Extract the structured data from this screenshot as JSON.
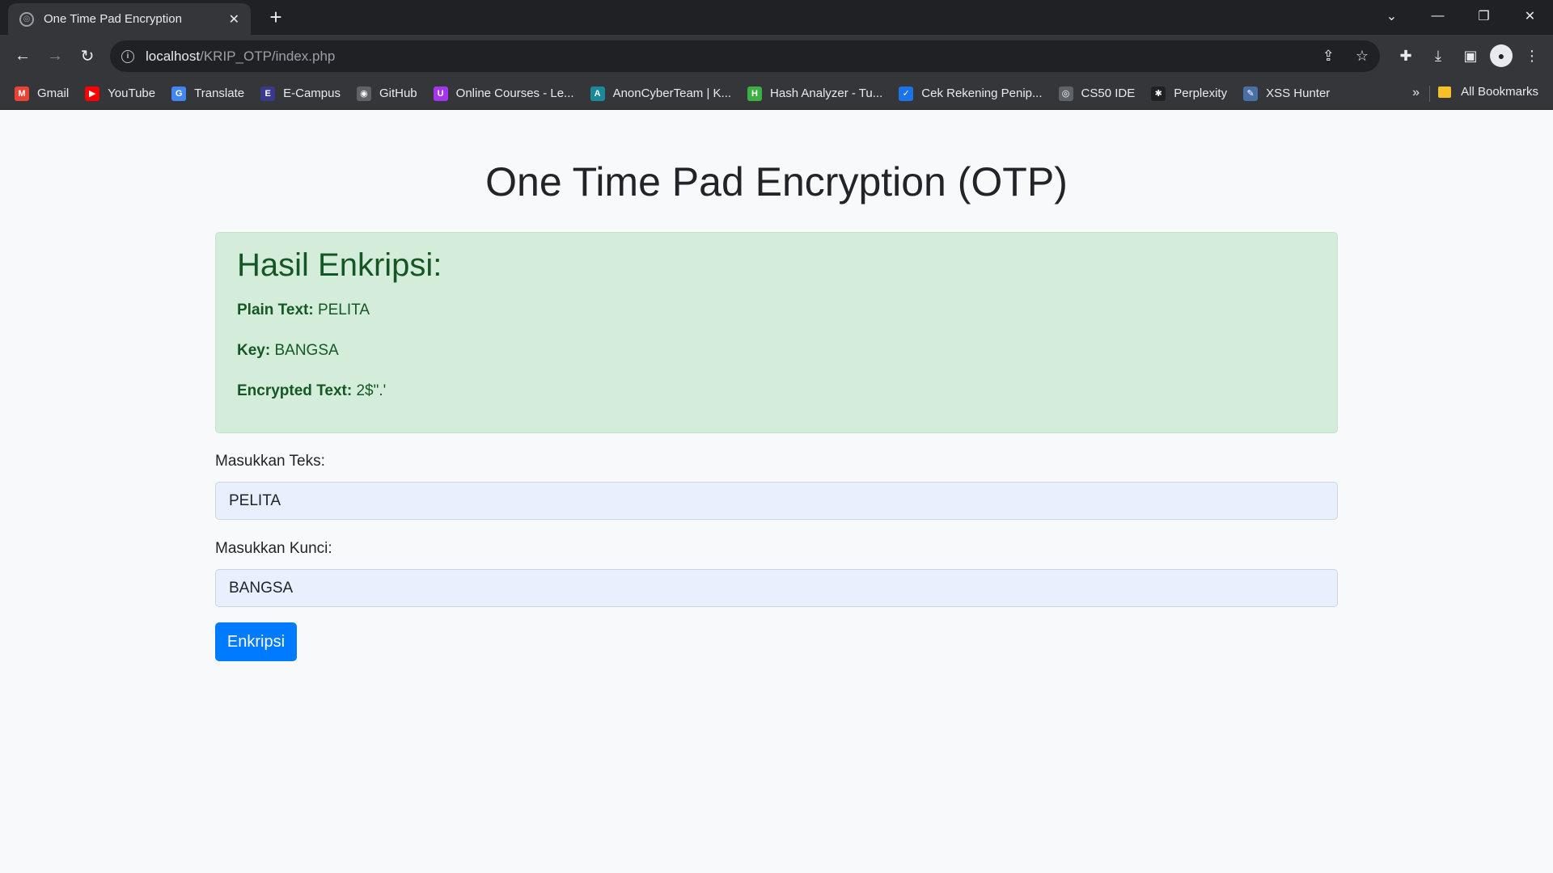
{
  "browser": {
    "tab_title": "One Time Pad Encryption",
    "url_host": "localhost",
    "url_path": "/KRIP_OTP/index.php",
    "bookmarks": [
      {
        "label": "Gmail",
        "icon": "gmail-icon",
        "color": "#ea4335",
        "glyph": "M"
      },
      {
        "label": "YouTube",
        "icon": "youtube-icon",
        "color": "#ff0000",
        "glyph": "▶"
      },
      {
        "label": "Translate",
        "icon": "translate-icon",
        "color": "#4285f4",
        "glyph": "G"
      },
      {
        "label": "E-Campus",
        "icon": "ecampus-icon",
        "color": "#3a3a8c",
        "glyph": "E"
      },
      {
        "label": "GitHub",
        "icon": "github-icon",
        "color": "#5f6368",
        "glyph": "◉"
      },
      {
        "label": "Online Courses - Le...",
        "icon": "udemy-icon",
        "color": "#a435f0",
        "glyph": "U"
      },
      {
        "label": "AnonCyberTeam | K...",
        "icon": "anoncyberteam-icon",
        "color": "#1a8a9a",
        "glyph": "A"
      },
      {
        "label": "Hash Analyzer - Tu...",
        "icon": "hash-analyzer-icon",
        "color": "#3cb043",
        "glyph": "H"
      },
      {
        "label": "Cek Rekening Penip...",
        "icon": "check-icon",
        "color": "#1a73e8",
        "glyph": "✓"
      },
      {
        "label": "CS50 IDE",
        "icon": "globe-icon",
        "color": "#5f6368",
        "glyph": "◎"
      },
      {
        "label": "Perplexity",
        "icon": "perplexity-icon",
        "color": "#202124",
        "glyph": "✱"
      },
      {
        "label": "XSS Hunter",
        "icon": "xss-hunter-icon",
        "color": "#4a6fa5",
        "glyph": "✎"
      }
    ],
    "bookmarks_more": "»",
    "all_bookmarks": "All Bookmarks"
  },
  "page": {
    "title": "One Time Pad Encryption (OTP)",
    "result": {
      "heading": "Hasil Enkripsi:",
      "plain_label": "Plain Text:",
      "plain_value": "PELITA",
      "key_label": "Key:",
      "key_value": "BANGSA",
      "encrypted_label": "Encrypted Text:",
      "encrypted_value": "2$\".'"
    },
    "form": {
      "text_label": "Masukkan Teks:",
      "text_value": "PELITA",
      "key_label": "Masukkan Kunci:",
      "key_value": "BANGSA",
      "submit_label": "Enkripsi"
    }
  }
}
